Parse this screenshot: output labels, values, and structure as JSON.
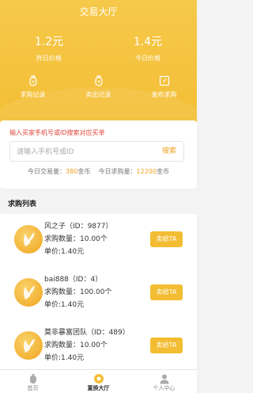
{
  "header": {
    "title": "交易大厅"
  },
  "prices": {
    "yesterday": {
      "value": "1.2元",
      "label": "昨日价格"
    },
    "today": {
      "value": "1.4元",
      "label": "今日价格"
    }
  },
  "actions": [
    {
      "label": "求购记录",
      "icon": "money-bag-icon"
    },
    {
      "label": "卖出记录",
      "icon": "money-bag-icon"
    },
    {
      "label": "发布求购",
      "icon": "edit-icon"
    }
  ],
  "search": {
    "hint": "输入买家手机号或ID搜索对应买单",
    "placeholder": "请输入手机号或ID",
    "button": "搜索"
  },
  "stats": {
    "volume_label": "今日交易量：",
    "volume_value": "380",
    "volume_unit": "金币",
    "demand_label": "今日求购量：",
    "demand_value": "12200",
    "demand_unit": "金币"
  },
  "list": {
    "title": "求购列表",
    "sell_label": "卖给TA",
    "items": [
      {
        "name": "风之子（ID：9877）",
        "qty": "求购数量：10.00个",
        "price": "单价:1.40元"
      },
      {
        "name": "bai888（ID：4）",
        "qty": "求购数量：100.00个",
        "price": "单价:1.40元"
      },
      {
        "name": "莫非暴富团队（ID：489）",
        "qty": "求购数量：10.00个",
        "price": "单价:1.40元"
      }
    ]
  },
  "tabbar": [
    {
      "label": "首页",
      "icon": "money-bag-icon",
      "active": false
    },
    {
      "label": "置换大厅",
      "icon": "exchange-icon",
      "active": true
    },
    {
      "label": "个人中心",
      "icon": "user-icon",
      "active": false
    }
  ],
  "colors": {
    "brand": "#f3bd33",
    "accent": "#f0a11f",
    "warning": "#e0443a"
  }
}
